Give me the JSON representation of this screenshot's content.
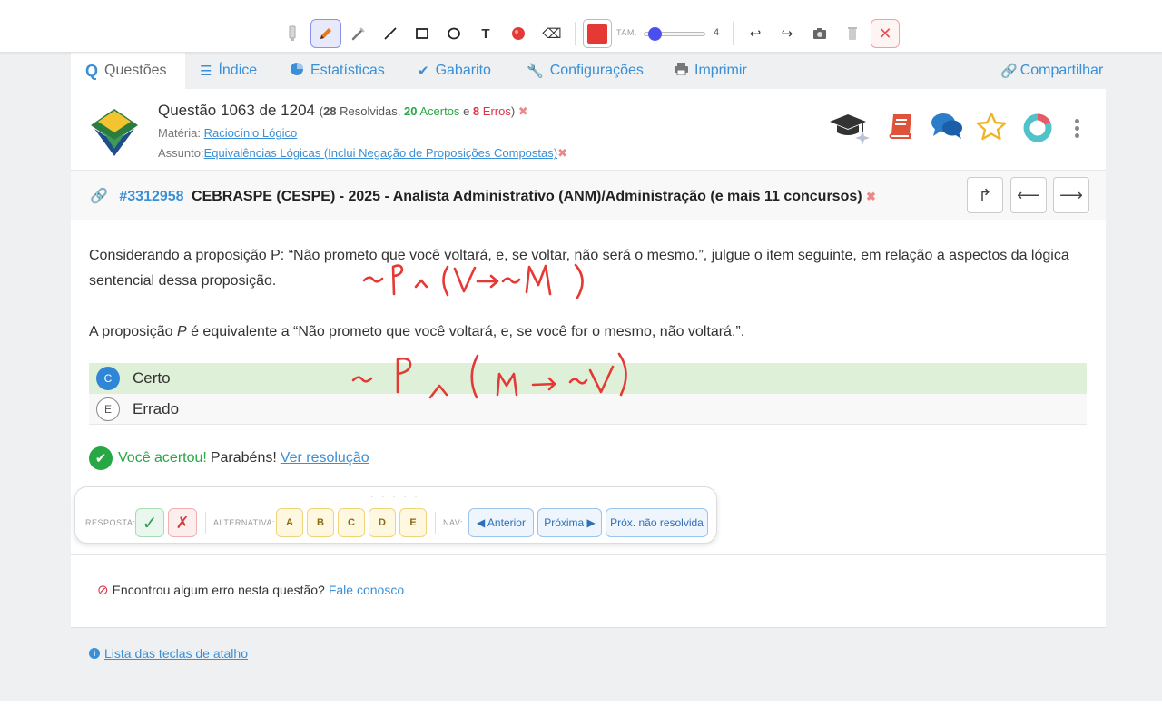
{
  "toolbar": {
    "tools": [
      "marker-icon",
      "pencil-icon",
      "highlighter-icon",
      "line-icon",
      "rectangle-icon",
      "ellipse-icon",
      "text-icon",
      "dot-icon",
      "eraser-icon"
    ],
    "text_tool_label": "T",
    "tam_label": "TAM.",
    "size_value": "4",
    "size_fraction": 0.1,
    "color": "#e53935",
    "undo_glyph": "↩",
    "redo_glyph": "↪"
  },
  "tabs": [
    {
      "label": "Questões",
      "icon": "q-logo-icon"
    },
    {
      "label": "Índice",
      "icon": "list-icon"
    },
    {
      "label": "Estatísticas",
      "icon": "pie-chart-icon"
    },
    {
      "label": "Gabarito",
      "icon": "check-icon"
    },
    {
      "label": "Configurações",
      "icon": "wrench-icon"
    },
    {
      "label": "Imprimir",
      "icon": "printer-icon"
    },
    {
      "label": "Compartilhar",
      "icon": "link-icon"
    }
  ],
  "question": {
    "title": "Questão 1063 de 1204",
    "resolved_count": "28",
    "resolved_label": "Resolvidas,",
    "hits_count": "20",
    "hits_label": "Acertos",
    "and_label": "e",
    "errors_count": "8",
    "errors_label": "Erros",
    "materia_label": "Matéria:",
    "materia_value": "Raciocínio Lógico",
    "assunto_label": "Assunto:",
    "assunto_value": "Equivalências Lógicas (Inclui Negação de Proposições Compostas)"
  },
  "source": {
    "id": "#3312958",
    "text": "CEBRASPE (CESPE) - 2025 - Analista Administrativo (ANM)/Administração (e mais 11 concursos)"
  },
  "statement": {
    "line1": "Considerando a proposição P: “Não prometo que você voltará, e, se voltar, não será o mesmo.”, julgue o item seguinte, em relação a aspectos da lógica sentencial dessa proposição.",
    "line2_prefix": "A proposição ",
    "line2_var": "P",
    "line2_suffix": " é equivalente a “Não prometo que você voltará, e, se você for o mesmo, não voltará.”."
  },
  "options": [
    {
      "letter": "C",
      "label": "Certo",
      "selected": true
    },
    {
      "letter": "E",
      "label": "Errado",
      "selected": false
    }
  ],
  "result": {
    "success": "Você acertou!",
    "congrats": "Parabéns!",
    "link": "Ver resolução"
  },
  "answer_bar": {
    "resposta_label": "RESPOSTA:",
    "alternativa_label": "ALTERNATIVA:",
    "nav_label": "NAV:",
    "alternatives": [
      "A",
      "B",
      "C",
      "D",
      "E"
    ],
    "prev_label": "◀ Anterior",
    "next_label": "Próxima ▶",
    "next_unresolved_label": "Próx. não resolvida"
  },
  "footer": {
    "error_text": "Encontrou algum erro nesta questão?",
    "contact_link": "Fale conosco",
    "shortcuts_link": "Lista das teclas de atalho"
  },
  "colors": {
    "accent": "#3a8fd6",
    "success": "#28a745",
    "error": "#dc3545",
    "ink": "#e53935",
    "selected_option_bg": "#dff0d8"
  }
}
